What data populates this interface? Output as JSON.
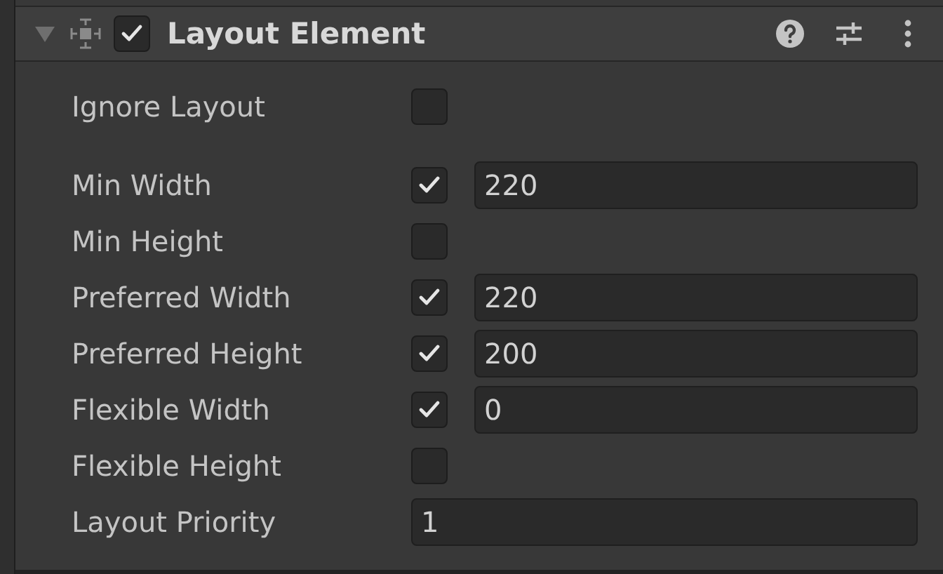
{
  "component": {
    "title": "Layout Element",
    "enabled": true,
    "expanded": true
  },
  "fields": [
    {
      "kind": "toggle",
      "label": "Ignore Layout",
      "checked": false
    },
    {
      "kind": "toggle_value",
      "label": "Min Width",
      "checked": true,
      "value": "220"
    },
    {
      "kind": "toggle_value",
      "label": "Min Height",
      "checked": false
    },
    {
      "kind": "toggle_value",
      "label": "Preferred Width",
      "checked": true,
      "value": "220"
    },
    {
      "kind": "toggle_value",
      "label": "Preferred Height",
      "checked": true,
      "value": "200"
    },
    {
      "kind": "toggle_value",
      "label": "Flexible Width",
      "checked": true,
      "value": "0"
    },
    {
      "kind": "toggle_value",
      "label": "Flexible Height",
      "checked": false
    },
    {
      "kind": "value",
      "label": "Layout Priority",
      "value": "1"
    }
  ]
}
